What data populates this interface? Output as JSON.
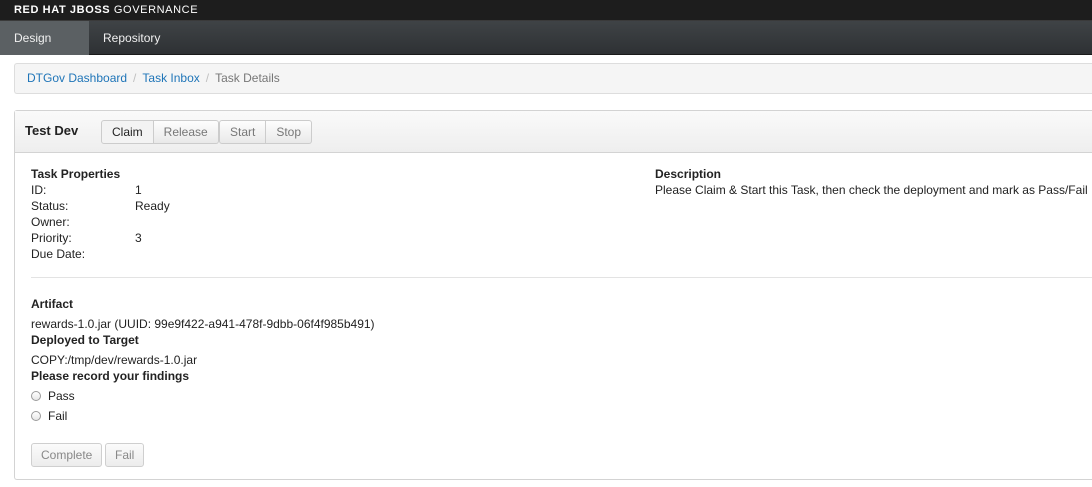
{
  "brand": {
    "part1": "RED HAT JBOSS",
    "part2": "GOVERNANCE"
  },
  "nav": {
    "tabs": [
      {
        "label": "Design Time",
        "active": true
      },
      {
        "label": "Repository",
        "active": false
      }
    ]
  },
  "breadcrumb": {
    "items": [
      "DTGov Dashboard",
      "Task Inbox",
      "Task Details"
    ]
  },
  "panel": {
    "title": "Test Dev",
    "buttons": {
      "claim": "Claim",
      "release": "Release",
      "start": "Start",
      "stop": "Stop"
    }
  },
  "properties": {
    "heading": "Task Properties",
    "rows": [
      {
        "label": "ID:",
        "value": "1"
      },
      {
        "label": "Status:",
        "value": "Ready"
      },
      {
        "label": "Owner:",
        "value": ""
      },
      {
        "label": "Priority:",
        "value": "3"
      },
      {
        "label": "Due Date:",
        "value": ""
      }
    ]
  },
  "description": {
    "heading": "Description",
    "text": "Please Claim & Start this Task, then check the deployment and mark as Pass/Fail"
  },
  "artifact": {
    "heading": "Artifact",
    "value": "rewards-1.0.jar (UUID: 99e9f422-a941-478f-9dbb-06f4f985b491)"
  },
  "deployed": {
    "heading": "Deployed to Target",
    "value": "COPY:/tmp/dev/rewards-1.0.jar"
  },
  "findings": {
    "heading": "Please record your findings",
    "options": [
      "Pass",
      "Fail"
    ]
  },
  "footer": {
    "complete": "Complete",
    "fail": "Fail"
  }
}
